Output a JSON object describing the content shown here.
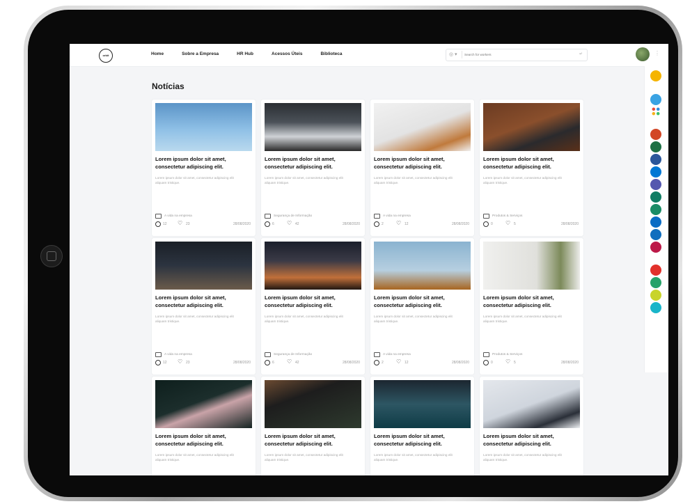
{
  "header": {
    "logo_text": "orbit",
    "nav": [
      "Home",
      "Sobre a Empresa",
      "HR Hub",
      "Acessos Úteis",
      "Biblioteca"
    ],
    "search_placeholder": "Search for workers",
    "search_scope_icon": "globe-icon",
    "enter_icon": "enter-icon"
  },
  "page": {
    "title": "Notícias"
  },
  "apps": [
    {
      "name": "favorites-icon",
      "color": "#f5b400"
    },
    {
      "name": "teams-people-icon",
      "color": "#3aa3e3"
    },
    {
      "name": "apps-grid-icon",
      "color": "#e8eef5"
    },
    {
      "name": "powerpoint-icon",
      "color": "#d24726"
    },
    {
      "name": "excel-icon",
      "color": "#1d7044"
    },
    {
      "name": "word-icon",
      "color": "#2b579a"
    },
    {
      "name": "outlook-icon",
      "color": "#0078d4"
    },
    {
      "name": "teams-icon",
      "color": "#5558af"
    },
    {
      "name": "onenote-exchange-icon",
      "color": "#117d63"
    },
    {
      "name": "sharepoint-icon",
      "color": "#1b8c66"
    },
    {
      "name": "onedrive-icon",
      "color": "#0a6cc4"
    },
    {
      "name": "yammer-icon",
      "color": "#106ebe"
    },
    {
      "name": "stream-icon",
      "color": "#bc1948"
    },
    {
      "name": "food-icon",
      "color": "#e2312b"
    },
    {
      "name": "car-icon",
      "color": "#26a269"
    },
    {
      "name": "smile-icon",
      "color": "#c8d42a"
    },
    {
      "name": "chat-icon",
      "color": "#19b5c9"
    }
  ],
  "cards": [
    {
      "title": "Lorem ipsum dolor sit amet, consectetur adipiscing elit.",
      "desc": "Lorem ipsum dolor sit amet, consectetur adipiscing elit aliquam tristique.",
      "category": "A vida na empresa",
      "comments": "12",
      "likes": "23",
      "date": "28/08/2020"
    },
    {
      "title": "Lorem ipsum dolor sit amet, consectetur adipiscing elit.",
      "desc": "Lorem ipsum dolor sit amet, consectetur adipiscing elit aliquam tristique.",
      "category": "Segurança de Informação",
      "comments": "6",
      "likes": "42",
      "date": "28/08/2020"
    },
    {
      "title": "Lorem ipsum dolor sit amet, consectetur adipiscing elit.",
      "desc": "Lorem ipsum dolor sit amet, consectetur adipiscing elit aliquam tristique.",
      "category": "A vida na empresa",
      "comments": "2",
      "likes": "12",
      "date": "28/08/2020"
    },
    {
      "title": "Lorem ipsum dolor sit amet, consectetur adipiscing elit.",
      "desc": "Lorem ipsum dolor sit amet, consectetur adipiscing elit aliquam tristique.",
      "category": "Produtos & Serviços",
      "comments": "0",
      "likes": "5",
      "date": "28/08/2020"
    },
    {
      "title": "Lorem ipsum dolor sit amet, consectetur adipiscing elit.",
      "desc": "Lorem ipsum dolor sit amet, consectetur adipiscing elit aliquam tristique.",
      "category": "A vida na empresa",
      "comments": "12",
      "likes": "23",
      "date": "28/08/2020"
    },
    {
      "title": "Lorem ipsum dolor sit amet, consectetur adipiscing elit.",
      "desc": "Lorem ipsum dolor sit amet, consectetur adipiscing elit aliquam tristique.",
      "category": "Segurança de Informação",
      "comments": "6",
      "likes": "42",
      "date": "28/08/2020"
    },
    {
      "title": "Lorem ipsum dolor sit amet, consectetur adipiscing elit.",
      "desc": "Lorem ipsum dolor sit amet, consectetur adipiscing elit aliquam tristique.",
      "category": "A vida na empresa",
      "comments": "2",
      "likes": "12",
      "date": "28/08/2020"
    },
    {
      "title": "Lorem ipsum dolor sit amet, consectetur adipiscing elit.",
      "desc": "Lorem ipsum dolor sit amet, consectetur adipiscing elit aliquam tristique.",
      "category": "Produtos & Serviços",
      "comments": "0",
      "likes": "5",
      "date": "28/08/2020"
    },
    {
      "title": "Lorem ipsum dolor sit amet, consectetur adipiscing elit.",
      "desc": "Lorem ipsum dolor sit amet, consectetur adipiscing elit aliquam tristique."
    },
    {
      "title": "Lorem ipsum dolor sit amet, consectetur adipiscing elit.",
      "desc": "Lorem ipsum dolor sit amet, consectetur adipiscing elit aliquam tristique."
    },
    {
      "title": "Lorem ipsum dolor sit amet, consectetur adipiscing elit.",
      "desc": "Lorem ipsum dolor sit amet, consectetur adipiscing elit aliquam tristique."
    },
    {
      "title": "Lorem ipsum dolor sit amet, consectetur adipiscing elit.",
      "desc": "Lorem ipsum dolor sit amet, consectetur adipiscing elit aliquam tristique."
    }
  ],
  "photo_scenes": [
    "telecom-tower-photo",
    "imac-desk-photo",
    "leather-wallet-phone-photo",
    "laptop-watch-desk-photo",
    "laptop-code-dark-photo",
    "silhouette-camera-sunset-photo",
    "error-dialog-screen-photo",
    "white-plant-photo",
    "dark-rose-photo",
    "stock-app-phone-photo",
    "laptop-keyboard-glow-photo",
    "iphone-box-photo"
  ]
}
